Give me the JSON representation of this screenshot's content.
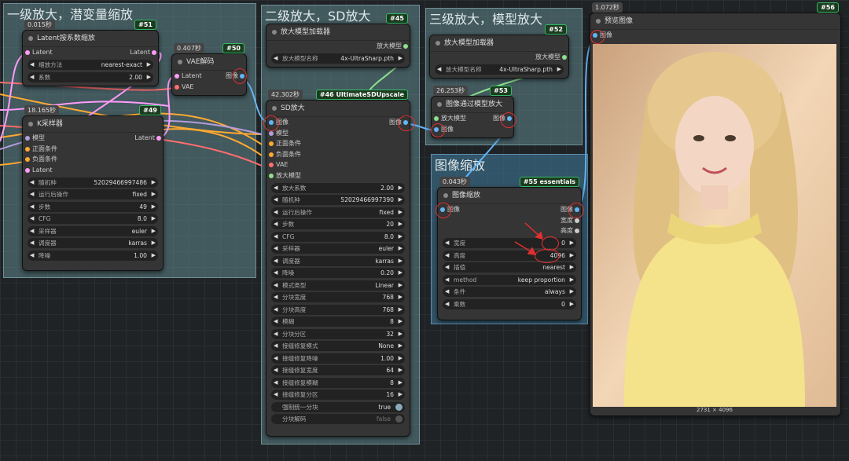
{
  "groups": {
    "g1": "一级放大，潜变量缩放",
    "g2": "二级放大，SD放大",
    "g3": "三级放大，模型放大",
    "g4": "图像缩放"
  },
  "nodes": {
    "latent_scale": {
      "time": "0.015秒",
      "id": "#51",
      "title": "Latent按系数缩放",
      "in_latent": "Latent",
      "out_latent": "Latent",
      "w": [
        {
          "l": "缩放方法",
          "v": "nearest-exact"
        },
        {
          "l": "系数",
          "v": "2.00"
        }
      ]
    },
    "vae_decode": {
      "time": "0.407秒",
      "id": "#50",
      "title": "VAE解码",
      "in_latent": "Latent",
      "in_vae": "VAE",
      "out_image": "图像"
    },
    "ksampler": {
      "time": "18.165秒",
      "id": "#49",
      "title": "K采样器",
      "inputs": [
        "模型",
        "正面条件",
        "负面条件",
        "Latent"
      ],
      "out_latent": "Latent",
      "w": [
        {
          "l": "随机种",
          "v": "52029466997486"
        },
        {
          "l": "运行后操作",
          "v": "fixed"
        },
        {
          "l": "步数",
          "v": "49"
        },
        {
          "l": "CFG",
          "v": "8.0"
        },
        {
          "l": "采样器",
          "v": "euler"
        },
        {
          "l": "调度器",
          "v": "karras"
        },
        {
          "l": "降噪",
          "v": "1.00"
        }
      ]
    },
    "upscale_loader_1": {
      "id": "#45",
      "title": "放大模型加载器",
      "out": "放大模型",
      "w": [
        {
          "l": "放大模型名称",
          "v": "4x-UltraSharp.pth"
        }
      ]
    },
    "sd_upscale": {
      "time": "42.302秒",
      "id": "#46 UltimateSDUpscale",
      "title": "SD放大",
      "inputs": [
        "图像",
        "模型",
        "正面条件",
        "负面条件",
        "VAE",
        "放大模型"
      ],
      "out_image": "图像",
      "w": [
        {
          "l": "放大系数",
          "v": "2.00"
        },
        {
          "l": "随机种",
          "v": "52029466997390"
        },
        {
          "l": "运行后操作",
          "v": "fixed"
        },
        {
          "l": "步数",
          "v": "20"
        },
        {
          "l": "CFG",
          "v": "8.0"
        },
        {
          "l": "采样器",
          "v": "euler"
        },
        {
          "l": "调度器",
          "v": "karras"
        },
        {
          "l": "降噪",
          "v": "0.20"
        },
        {
          "l": "模式类型",
          "v": "Linear"
        },
        {
          "l": "分块宽度",
          "v": "768"
        },
        {
          "l": "分块高度",
          "v": "768"
        },
        {
          "l": "模糊",
          "v": "8"
        },
        {
          "l": "分块分区",
          "v": "32"
        },
        {
          "l": "接缝修复模式",
          "v": "None"
        },
        {
          "l": "接缝修复降噪",
          "v": "1.00"
        },
        {
          "l": "接缝修复宽度",
          "v": "64"
        },
        {
          "l": "接缝修复模糊",
          "v": "8"
        },
        {
          "l": "接缝修复分区",
          "v": "16"
        }
      ],
      "toggles": [
        {
          "l": "强制统一分块",
          "v": "true"
        },
        {
          "l": "分块解码",
          "v": "false"
        }
      ]
    },
    "upscale_loader_2": {
      "id": "#52",
      "title": "放大模型加载器",
      "out": "放大模型",
      "w": [
        {
          "l": "放大模型名称",
          "v": "4x-UltraSharp.pth"
        }
      ]
    },
    "image_upscale_model": {
      "time": "26.253秒",
      "id": "#53",
      "title": "图像通过模型放大",
      "in_model": "放大模型",
      "in_image": "图像",
      "out_image": "图像"
    },
    "image_resize": {
      "time": "0.043秒",
      "id": "#55 essentials",
      "title": "图像缩放",
      "in_image": "图像",
      "outs": [
        "图像",
        "宽度",
        "高度"
      ],
      "w": [
        {
          "l": "宽度",
          "v": "0"
        },
        {
          "l": "高度",
          "v": "4096"
        },
        {
          "l": "插值",
          "v": "nearest"
        },
        {
          "l": "method",
          "v": "keep proportion"
        },
        {
          "l": "条件",
          "v": "always"
        },
        {
          "l": "乘数",
          "v": "0"
        }
      ]
    },
    "preview": {
      "time": "1.072秒",
      "id": "#56",
      "title": "预览图像",
      "in_image": "图像",
      "size": "2731 × 4096"
    }
  },
  "colors": {
    "latent": "#ff9cf9",
    "image": "#64b5f6",
    "model": "#b39ddb",
    "clip": "#ffa931",
    "vae": "#ff6e6e",
    "upscale_model": "#8ee08e"
  }
}
